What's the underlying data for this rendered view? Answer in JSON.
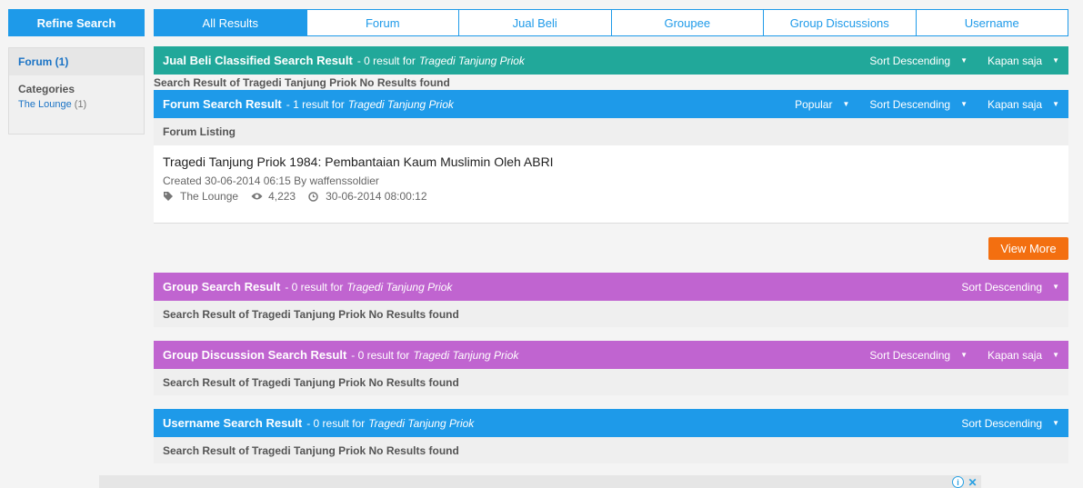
{
  "sidebar": {
    "refine_label": "Refine Search",
    "active_item": "Forum (1)",
    "categories_label": "Categories",
    "category": {
      "name": "The Lounge",
      "count": "(1)"
    }
  },
  "tabs": [
    {
      "label": "All Results",
      "active": true
    },
    {
      "label": "Forum"
    },
    {
      "label": "Jual Beli"
    },
    {
      "label": "Groupee"
    },
    {
      "label": "Group Discussions"
    },
    {
      "label": "Username"
    }
  ],
  "query": "Tragedi Tanjung Priok",
  "sections": {
    "jualbeli": {
      "title": "Jual Beli Classified Search Result",
      "count": "- 0 result for",
      "query": "Tragedi Tanjung Priok",
      "sort": "Sort Descending",
      "time": "Kapan saja",
      "note": "Search Result of Tragedi Tanjung Priok No Results found"
    },
    "forum": {
      "title": "Forum Search Result",
      "count": "- 1 result for",
      "query": "Tragedi Tanjung Priok",
      "popular": "Popular",
      "sort": "Sort Descending",
      "time": "Kapan saja",
      "listing_label": "Forum Listing"
    },
    "group": {
      "title": "Group Search Result",
      "count": "- 0 result for",
      "query": "Tragedi Tanjung Priok",
      "sort": "Sort Descending",
      "note": "Search Result of Tragedi Tanjung Priok No Results found"
    },
    "groupdisc": {
      "title": "Group Discussion Search Result",
      "count": "- 0 result for",
      "query": "Tragedi Tanjung Priok",
      "sort": "Sort Descending",
      "time": "Kapan saja",
      "note": "Search Result of Tragedi Tanjung Priok No Results found"
    },
    "username": {
      "title": "Username Search Result",
      "count": "- 0 result for",
      "query": "Tragedi Tanjung Priok",
      "sort": "Sort Descending",
      "note": "Search Result of Tragedi Tanjung Priok No Results found"
    }
  },
  "result": {
    "title": "Tragedi Tanjung Priok 1984: Pembantaian Kaum Muslimin Oleh ABRI",
    "meta": "Created 30-06-2014 06:15 By waffenssoldier",
    "category": "The Lounge",
    "views": "4,223",
    "last_update": "30-06-2014 08:00:12"
  },
  "view_more_label": "View More",
  "colors": {
    "blue": "#1e9ae9",
    "teal": "#21a89a",
    "purple": "#c064d0",
    "orange": "#f36f10"
  },
  "icons": {
    "tag": "tag-icon",
    "eye": "eye-icon",
    "clock": "clock-icon",
    "caret": "caret-down-icon",
    "info": "info-icon",
    "close": "close-icon"
  }
}
